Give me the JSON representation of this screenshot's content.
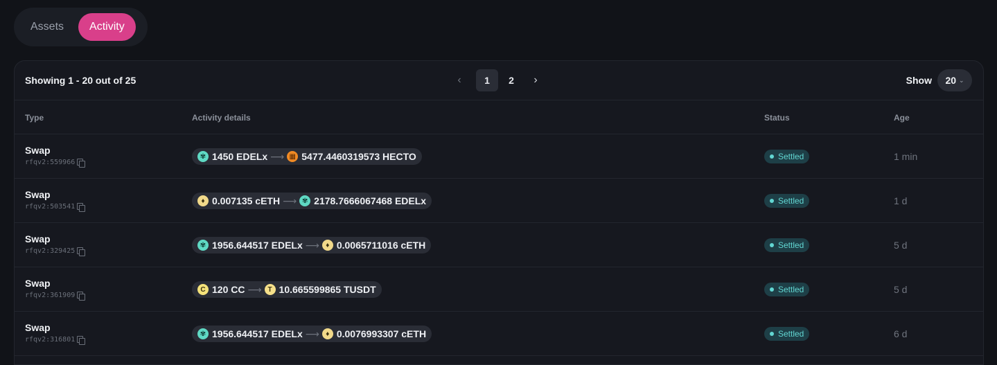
{
  "tabs": [
    {
      "label": "Assets",
      "active": false
    },
    {
      "label": "Activity",
      "active": true
    }
  ],
  "toolbar": {
    "showing_text": "Showing 1 - 20 out of 25",
    "pagination": {
      "prev_icon": "chevron-left-icon",
      "pages": [
        "1",
        "2"
      ],
      "current": "1",
      "next_icon": "chevron-right-icon"
    },
    "show_label": "Show",
    "show_value": "20"
  },
  "table": {
    "columns": [
      "Type",
      "Activity details",
      "Status",
      "Age"
    ],
    "rows": [
      {
        "type": "Swap",
        "id": "rfqv2:559966",
        "from": {
          "amount": "1450 EDELx",
          "icon": "edelx-icon"
        },
        "to": {
          "amount": "5477.4460319573 HECTO",
          "icon": "hecto-icon"
        },
        "status": "Settled",
        "age": "1 min"
      },
      {
        "type": "Swap",
        "id": "rfqv2:503541",
        "from": {
          "amount": "0.007135 cETH",
          "icon": "ceth-icon"
        },
        "to": {
          "amount": "2178.7666067468 EDELx",
          "icon": "edelx-icon"
        },
        "status": "Settled",
        "age": "1 d"
      },
      {
        "type": "Swap",
        "id": "rfqv2:329425",
        "from": {
          "amount": "1956.644517 EDELx",
          "icon": "edelx-icon"
        },
        "to": {
          "amount": "0.0065711016 cETH",
          "icon": "ceth-icon"
        },
        "status": "Settled",
        "age": "5 d"
      },
      {
        "type": "Swap",
        "id": "rfqv2:361909",
        "from": {
          "amount": "120 CC",
          "icon": "cc-icon"
        },
        "to": {
          "amount": "10.665599865 TUSDT",
          "icon": "tusdt-icon"
        },
        "status": "Settled",
        "age": "5 d"
      },
      {
        "type": "Swap",
        "id": "rfqv2:316801",
        "from": {
          "amount": "1956.644517 EDELx",
          "icon": "edelx-icon"
        },
        "to": {
          "amount": "0.0076993307 cETH",
          "icon": "ceth-icon"
        },
        "status": "Settled",
        "age": "6 d"
      }
    ]
  },
  "colors": {
    "accent": "#d93f8a",
    "status_settled": "#62d6d2",
    "edelx": "#5fd9c4",
    "hecto": "#f08a24",
    "ceth": "#f1d98a",
    "cc": "#f4e27a",
    "tusdt": "#f5e08a"
  }
}
